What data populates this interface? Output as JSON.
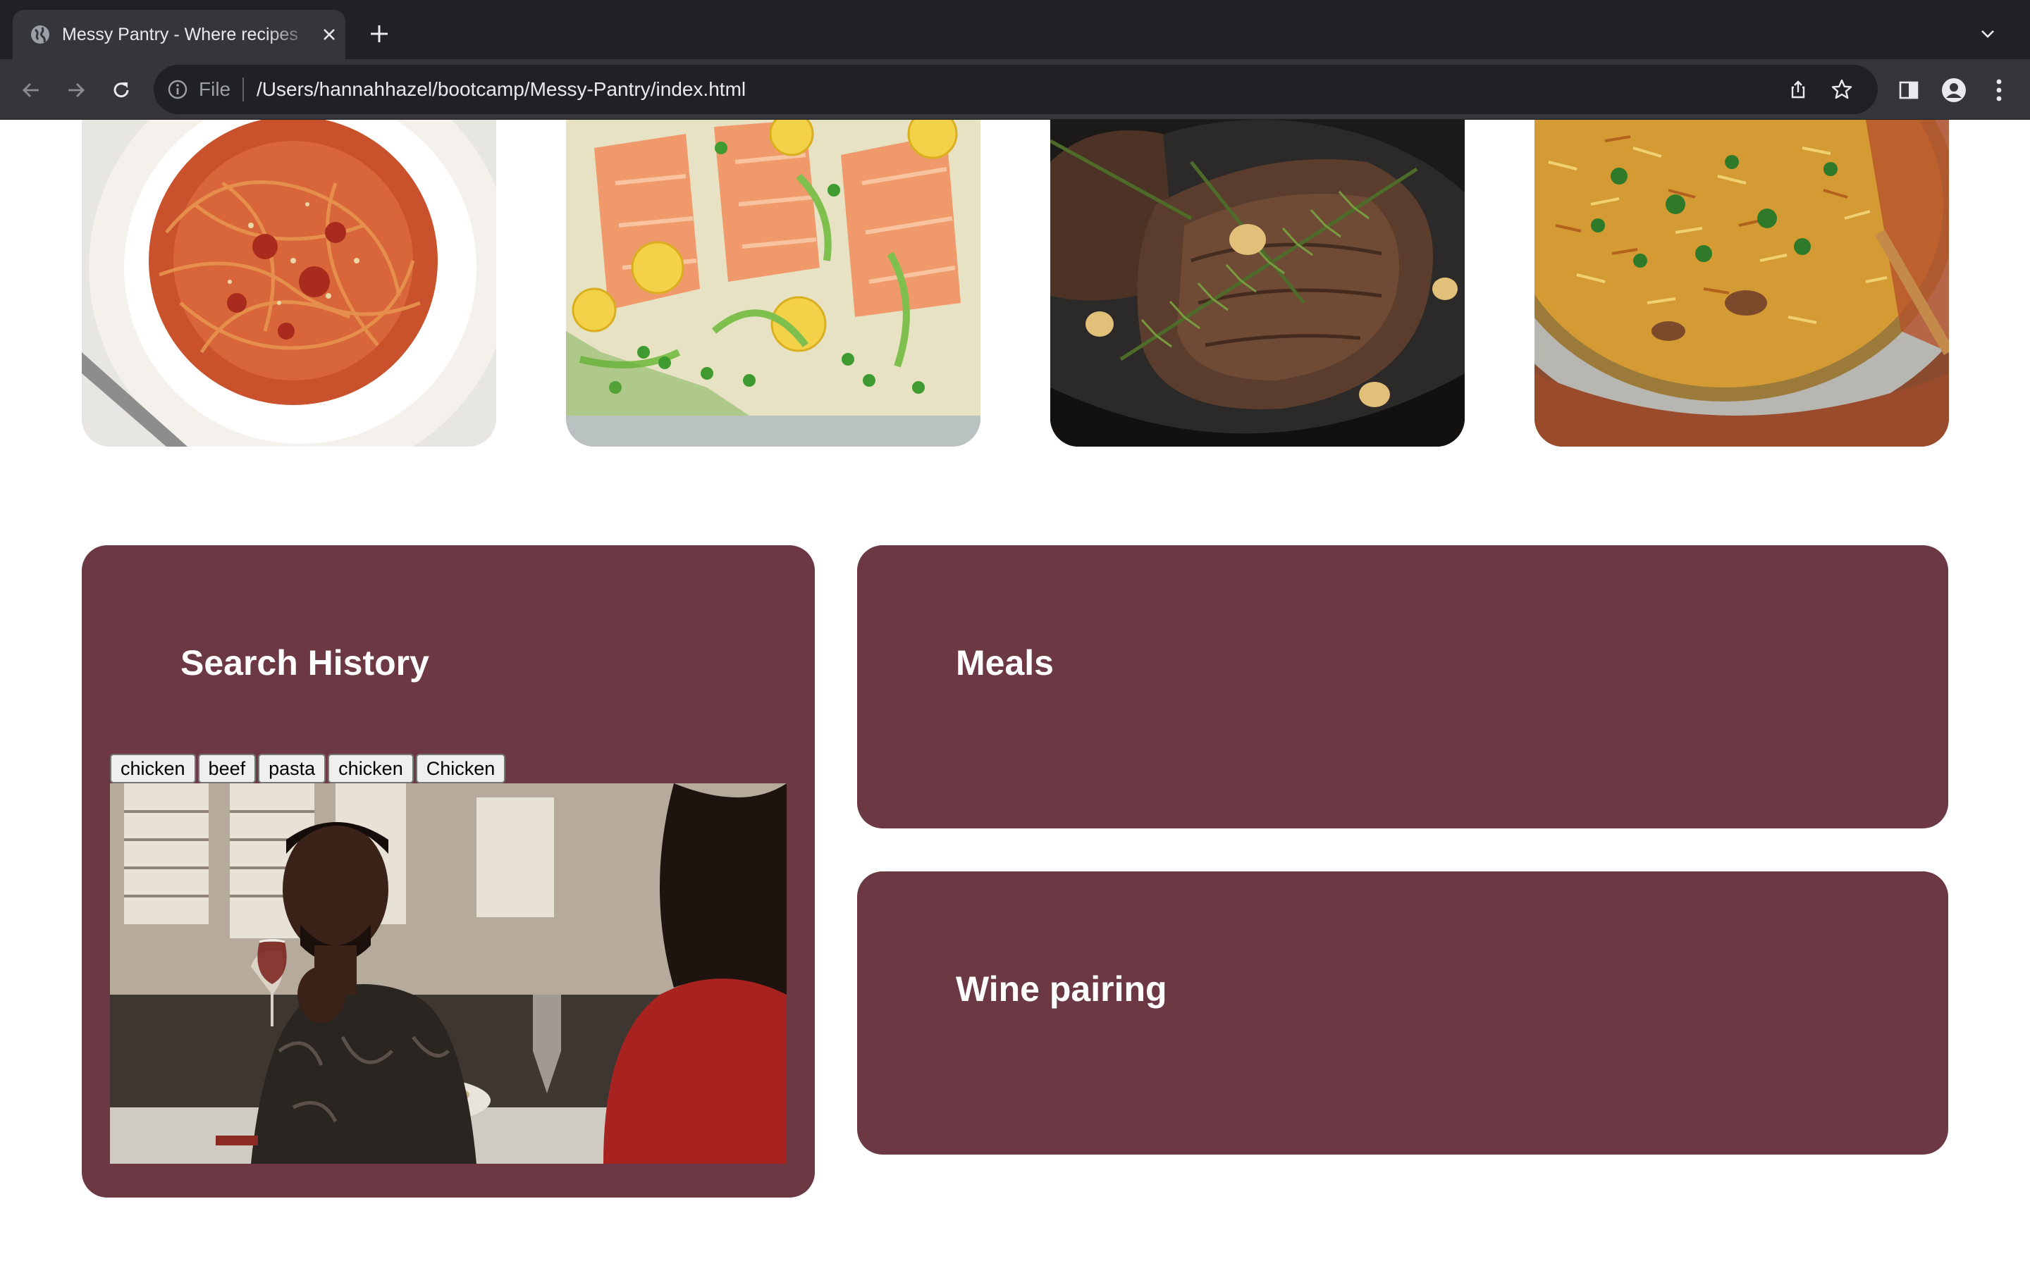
{
  "browser": {
    "tab_title": "Messy Pantry - Where recipes",
    "url_scheme": "File",
    "url": "/Users/hannahhazel/bootcamp/Messy-Pantry/index.html",
    "chrome_color": "#202124",
    "toolbar_color": "#35363a"
  },
  "page": {
    "food_images": [
      {
        "name": "spaghetti-image"
      },
      {
        "name": "salmon-image"
      },
      {
        "name": "steak-image"
      },
      {
        "name": "biryani-image"
      }
    ],
    "card_color": "#6b3843",
    "search_history": {
      "title": "Search History",
      "buttons": [
        "chicken",
        "beef",
        "pasta",
        "chicken",
        "Chicken"
      ]
    },
    "meals": {
      "title": "Meals"
    },
    "wine_pairing": {
      "title": "Wine pairing"
    }
  }
}
